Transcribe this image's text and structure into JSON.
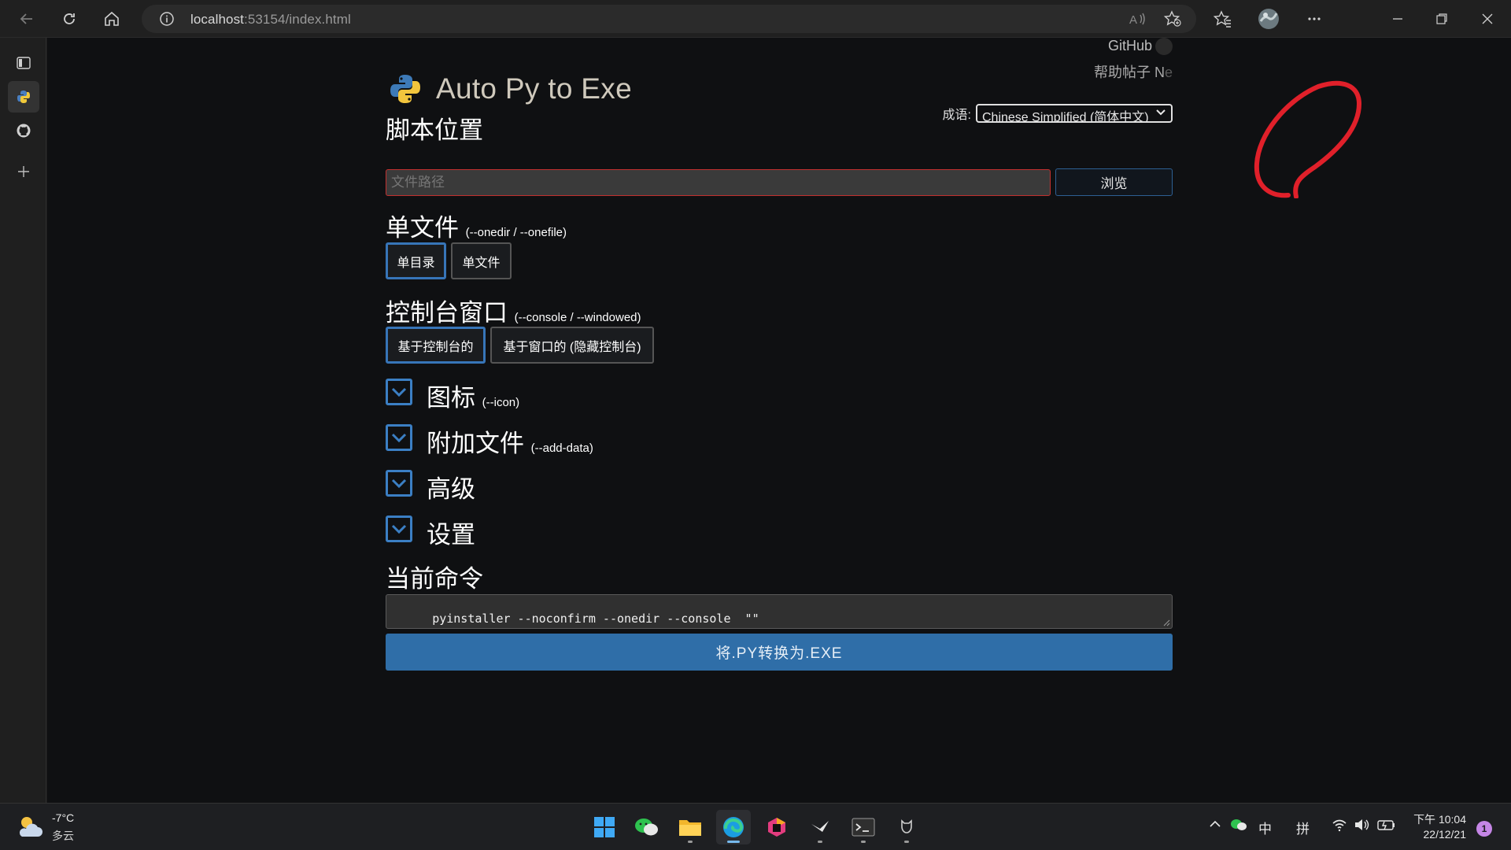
{
  "browser": {
    "url_host": "localhost",
    "url_rest": ":53154/index.html"
  },
  "app": {
    "title": "Auto Py to Exe",
    "github_link": "GitHub",
    "help_link_main": "帮助帖子 N",
    "help_link_fade": "e",
    "language_label": "成语:",
    "language_value": "Chinese Simplified (简体中文)"
  },
  "script_location": {
    "heading": "脚本位置",
    "placeholder": "文件路径",
    "browse_label": "浏览"
  },
  "onefile": {
    "heading": "单文件",
    "flag": "(--onedir / --onefile)",
    "option_onedir": "单目录",
    "option_onefile": "单文件",
    "selected": "单目录"
  },
  "console": {
    "heading": "控制台窗口",
    "flag": "(--console / --windowed)",
    "option_console": "基于控制台的",
    "option_windowed": "基于窗口的 (隐藏控制台)",
    "selected": "基于控制台的"
  },
  "sections": [
    {
      "label": "图标",
      "flag": "(--icon)"
    },
    {
      "label": "附加文件",
      "flag": "(--add-data)"
    },
    {
      "label": "高级",
      "flag": ""
    },
    {
      "label": "设置",
      "flag": ""
    }
  ],
  "current_command": {
    "heading": "当前命令",
    "command": "pyinstaller --noconfirm --onedir --console  \"\""
  },
  "convert_button": "将.PY转换为.EXE",
  "taskbar": {
    "temperature": "-7°C",
    "weather": "多云",
    "ime_mode": "中",
    "ime_input": "拼",
    "time": "下午 10:04",
    "date": "22/12/21",
    "notification_count": "1"
  },
  "colors": {
    "accent": "#3775b8",
    "convert_button": "#2f6ea8",
    "error_border": "#c2302f",
    "annotation": "#e0202a"
  }
}
